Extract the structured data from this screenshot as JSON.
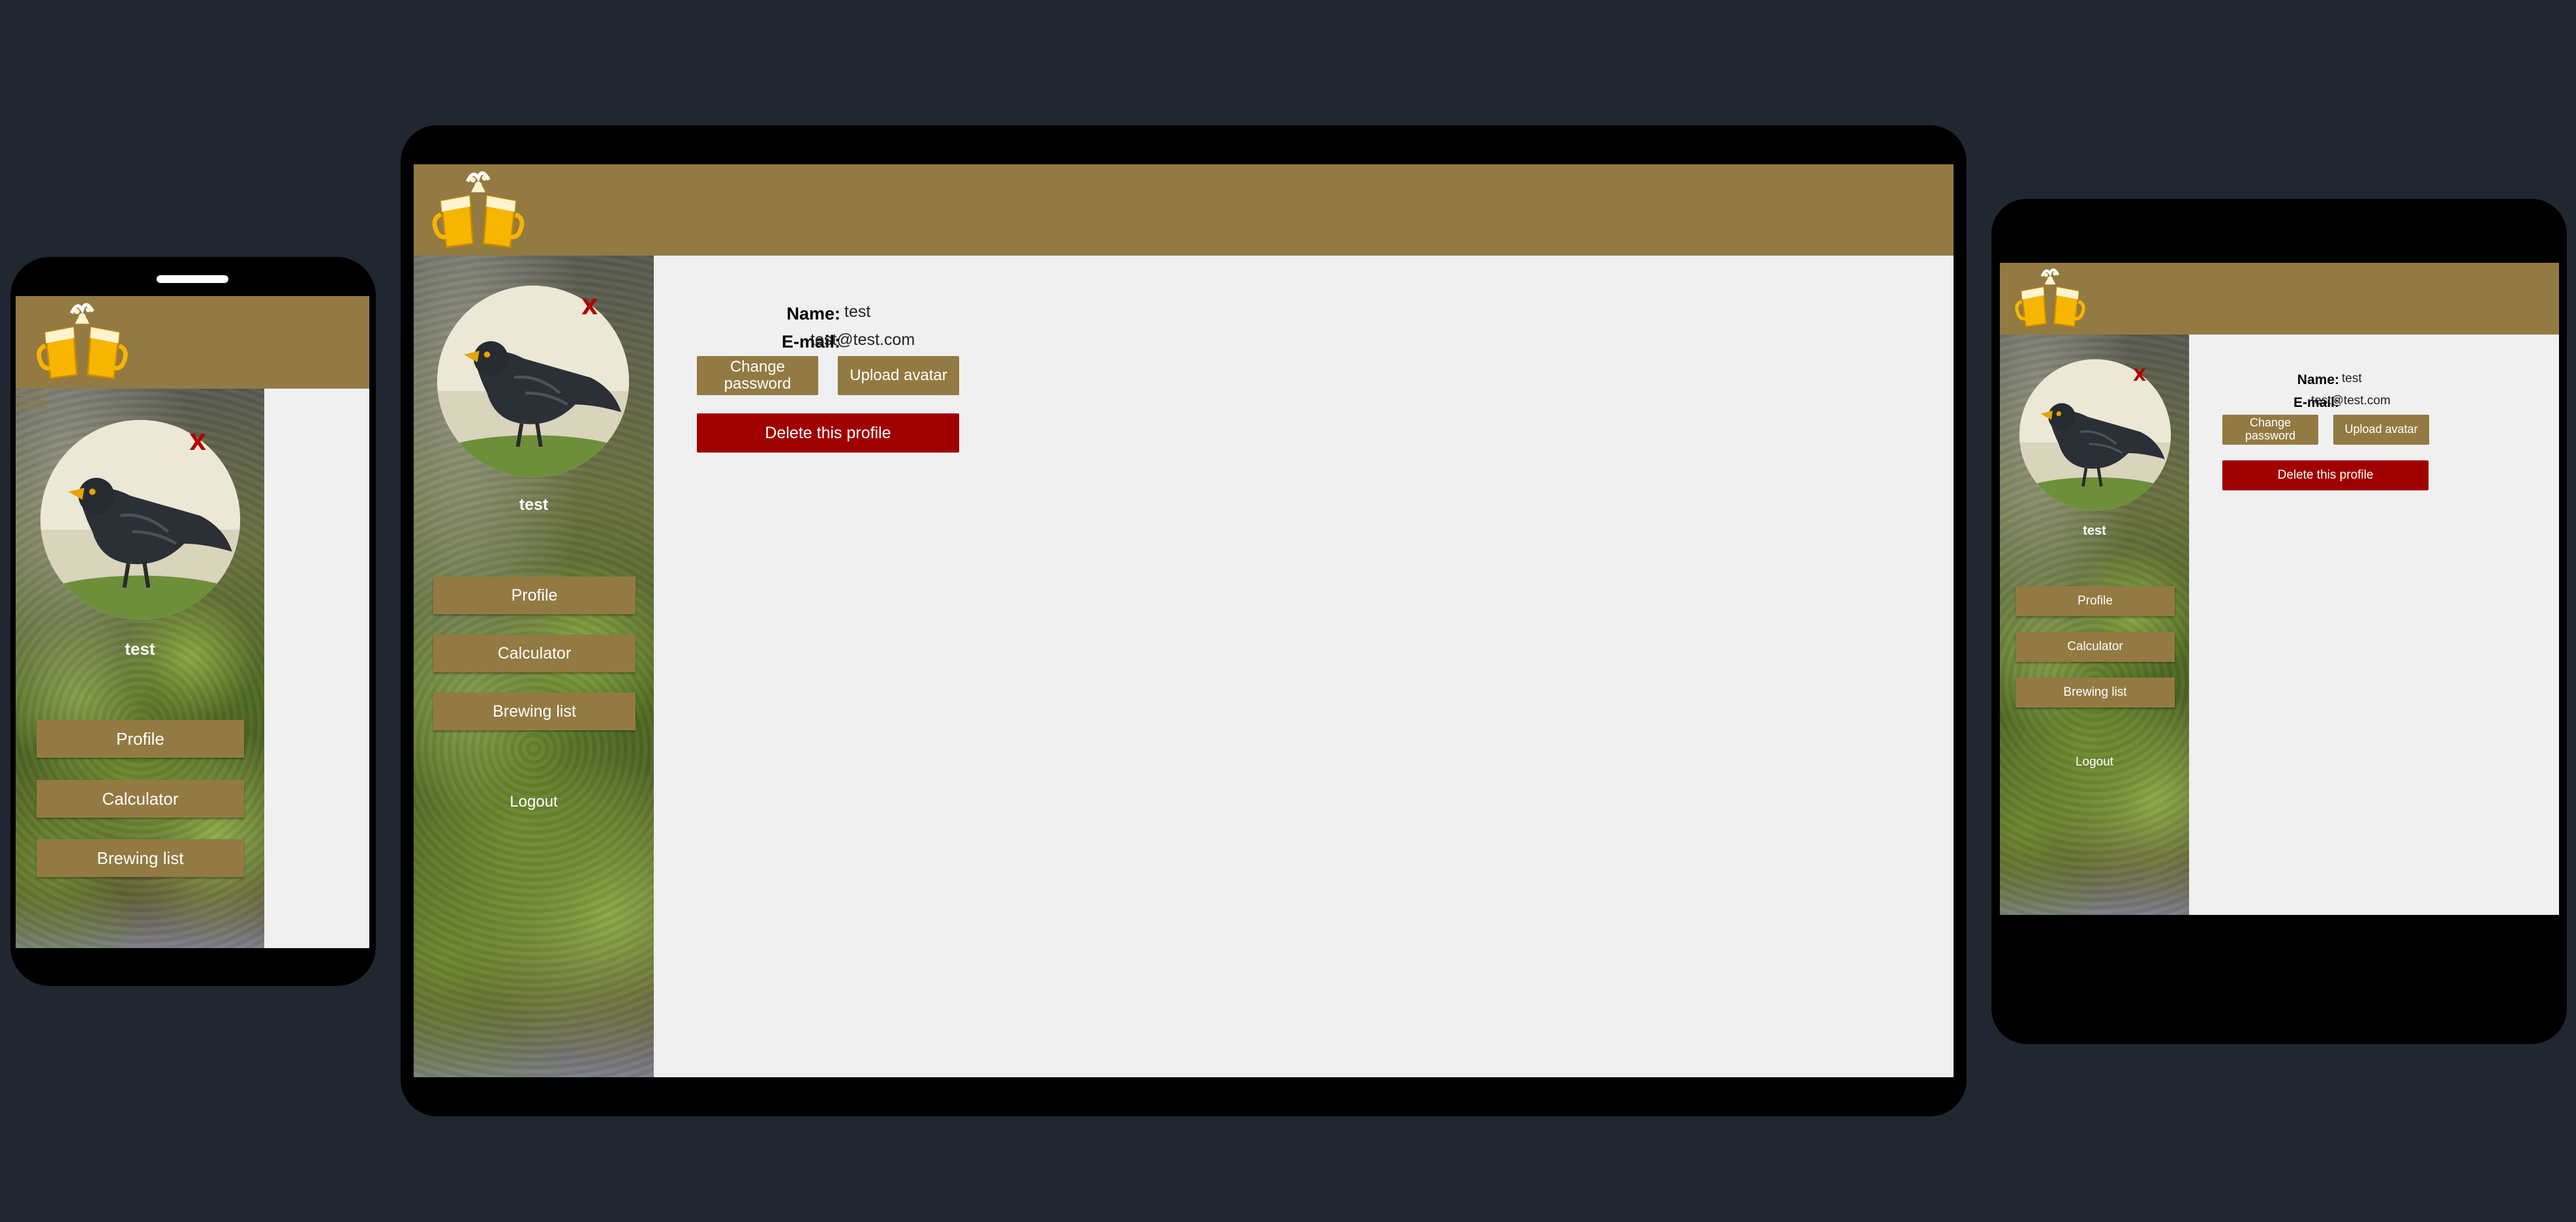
{
  "profile": {
    "name_label": "Name:",
    "name_value": "test",
    "email_label": "E-mail:",
    "email_value": "test@test.com"
  },
  "user": {
    "username": "test"
  },
  "avatar": {
    "close_label": "X"
  },
  "nav": {
    "profile": "Profile",
    "calculator": "Calculator",
    "brewing_list": "Brewing list",
    "logout": "Logout"
  },
  "actions": {
    "change_password": "Change password",
    "upload_avatar": "Upload avatar",
    "delete_profile": "Delete this profile"
  },
  "colors": {
    "background": "#212731",
    "header": "#937a42",
    "button": "#937a42",
    "danger": "#a00000",
    "content": "#f0f0f0"
  },
  "icons": {
    "logo": "beer-mugs-cheers-icon",
    "menu": "hamburger-menu-icon",
    "avatar": "blackbird-photo"
  }
}
